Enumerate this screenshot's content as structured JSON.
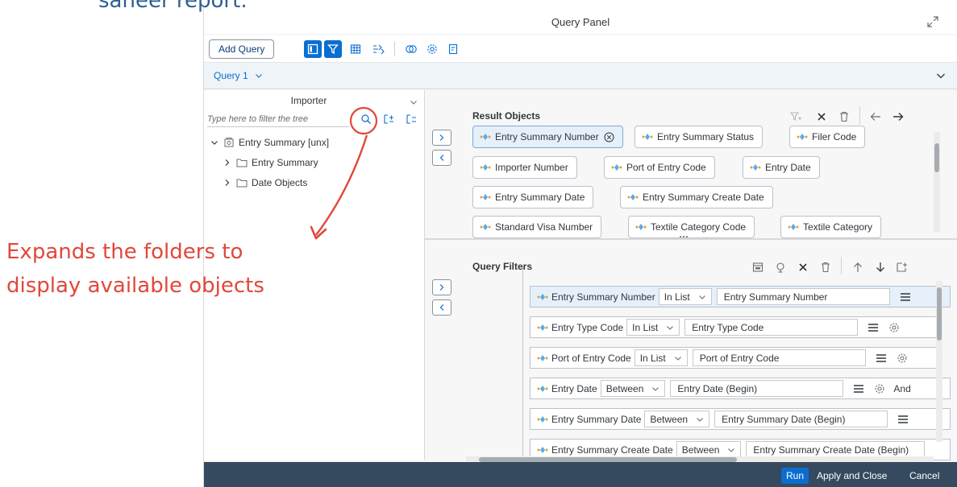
{
  "annotation": {
    "cut_heading": "saneer report.",
    "callout_line1": "Expands the folders to",
    "callout_line2": "display available objects",
    "accent_color": "#e0483b"
  },
  "window": {
    "title": "Query Panel",
    "expand_icon": "expand-icon"
  },
  "toolbar": {
    "add_query": "Add Query",
    "icons": [
      "panel-toggle-icon",
      "filter-icon",
      "table-icon",
      "data-preview-icon",
      "combined-query-icon",
      "settings-icon",
      "sql-icon"
    ]
  },
  "query_tabs": {
    "active": "Query 1"
  },
  "tree": {
    "universe_label": "Importer",
    "filter_placeholder": "Type here to filter the tree",
    "root": "Entry Summary [unx]",
    "folders": [
      "Entry Summary",
      "Date Objects"
    ]
  },
  "result_objects": {
    "title": "Result Objects",
    "chips": [
      "Entry Summary Number",
      "Entry Summary Status",
      "Filer Code",
      "Importer Number",
      "Port of Entry Code",
      "Entry Date",
      "Entry Summary Date",
      "Entry Summary Create Date",
      "Standard Visa Number",
      "Textile Category Code",
      "Textile Category"
    ]
  },
  "query_filters": {
    "title": "Query Filters",
    "rows": [
      {
        "name": "Entry Summary Number",
        "op": "In List",
        "value": "Entry Summary Number"
      },
      {
        "name": "Entry Type Code",
        "op": "In List",
        "value": "Entry Type Code"
      },
      {
        "name": "Port of Entry Code",
        "op": "In List",
        "value": "Port of Entry Code"
      },
      {
        "name": "Entry Date",
        "op": "Between",
        "value": "Entry Date (Begin)",
        "extra": "And"
      },
      {
        "name": "Entry Summary Date",
        "op": "Between",
        "value": "Entry Summary Date (Begin)"
      },
      {
        "name": "Entry Summary Create Date",
        "op": "Between",
        "value": "Entry Summary Create Date (Begin)"
      }
    ]
  },
  "footer": {
    "run": "Run",
    "apply_close": "Apply and Close",
    "cancel": "Cancel"
  },
  "colors": {
    "accent": "#0a6ed1",
    "footer_bg": "#354a5f",
    "tab_bg": "#eff4f9"
  }
}
